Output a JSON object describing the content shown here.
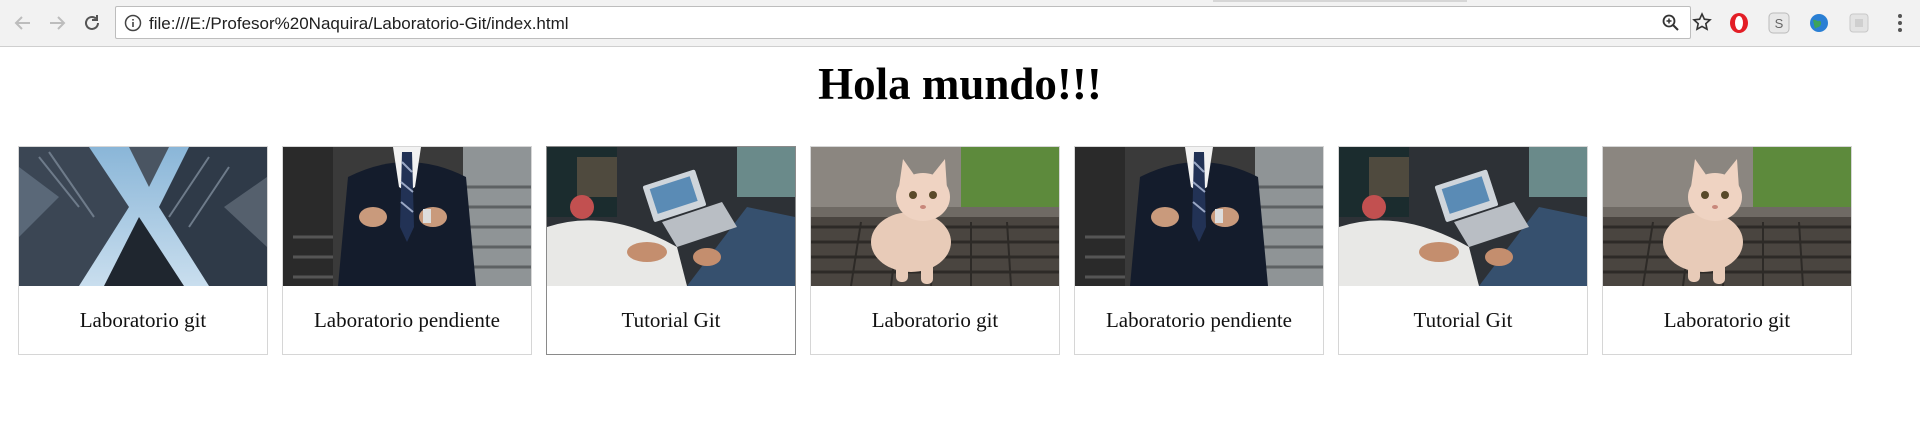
{
  "browser": {
    "url": "file:///E:/Profesor%20Naquira/Laboratorio-Git/index.html",
    "back_icon": "arrow-left-icon",
    "forward_icon": "arrow-right-icon",
    "reload_icon": "reload-icon",
    "extensions": [
      "opera-vpn-icon",
      "s-extension-icon",
      "globe-extension-icon",
      "puzzle-extension-icon"
    ]
  },
  "page": {
    "title": "Hola mundo!!!"
  },
  "cards": [
    {
      "label": "Laboratorio git",
      "image": "skyscrapers"
    },
    {
      "label": "Laboratorio pendiente",
      "image": "businessman-suit"
    },
    {
      "label": "Tutorial Git",
      "image": "people-laptop"
    },
    {
      "label": "Laboratorio git",
      "image": "kitten"
    },
    {
      "label": "Laboratorio pendiente",
      "image": "businessman-suit"
    },
    {
      "label": "Tutorial Git",
      "image": "people-laptop"
    },
    {
      "label": "Laboratorio git",
      "image": "kitten"
    }
  ]
}
